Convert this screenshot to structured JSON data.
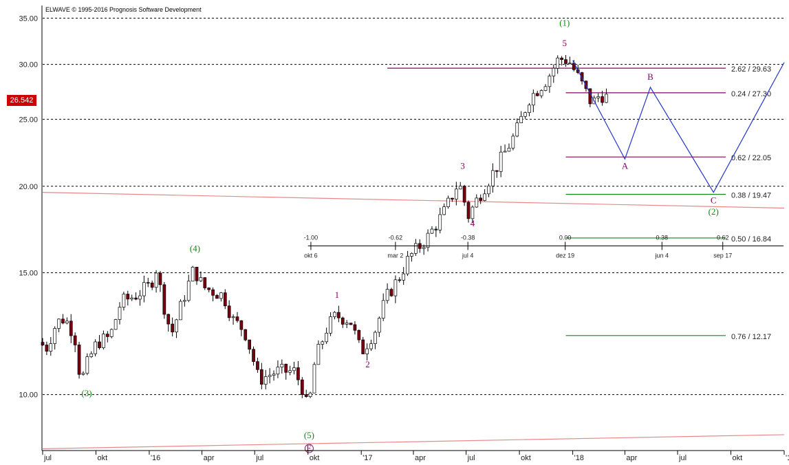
{
  "header": {
    "copyright": "ELWAVE © 1995-2016 Prognosis Software Development"
  },
  "price_badge": {
    "label": "26.542"
  },
  "colors": {
    "bull": "#ffffff",
    "bear": "#7a0010",
    "wick": "#000000",
    "projection": "#2233cc",
    "purple": "#880066",
    "green": "#118811",
    "channel": "#e88888",
    "grid": "#000000"
  },
  "chart_data": {
    "type": "candlestick",
    "y_scale": "log",
    "ylim": [
      8.3,
      36.5
    ],
    "y_ticks": [
      {
        "value": 35,
        "label": "35.00"
      },
      {
        "value": 30,
        "label": "30.00"
      },
      {
        "value": 25,
        "label": "25.00"
      },
      {
        "value": 20,
        "label": "20.00"
      },
      {
        "value": 15,
        "label": "15.00"
      },
      {
        "value": 10,
        "label": "10.00"
      }
    ],
    "x_axis": {
      "start": "2015-07-01",
      "end": "2019-01-01",
      "ticks": [
        {
          "date": "2015-07-01",
          "label": "jul"
        },
        {
          "date": "2015-10-01",
          "label": "okt"
        },
        {
          "date": "2016-01-01",
          "label": "'16"
        },
        {
          "date": "2016-04-01",
          "label": "apr"
        },
        {
          "date": "2016-07-01",
          "label": "jul"
        },
        {
          "date": "2016-10-01",
          "label": "okt"
        },
        {
          "date": "2017-01-01",
          "label": "'17"
        },
        {
          "date": "2017-04-01",
          "label": "apr"
        },
        {
          "date": "2017-07-01",
          "label": "jul"
        },
        {
          "date": "2017-10-01",
          "label": "okt"
        },
        {
          "date": "2018-01-01",
          "label": "'18"
        },
        {
          "date": "2018-04-01",
          "label": "apr"
        },
        {
          "date": "2018-07-01",
          "label": "jul"
        },
        {
          "date": "2018-10-01",
          "label": "okt"
        },
        {
          "date": "2019-01-01",
          "label": "'1"
        }
      ]
    },
    "price_path": [
      [
        "2015-07-01",
        11.9
      ],
      [
        "2015-07-15",
        11.7
      ],
      [
        "2015-08-01",
        12.7
      ],
      [
        "2015-08-15",
        12.9
      ],
      [
        "2015-09-01",
        12.2
      ],
      [
        "2015-09-12",
        10.4
      ],
      [
        "2015-09-25",
        11.2
      ],
      [
        "2015-10-10",
        11.9
      ],
      [
        "2015-11-01",
        12.1
      ],
      [
        "2015-11-20",
        13.6
      ],
      [
        "2015-12-15",
        13.9
      ],
      [
        "2016-01-10",
        14.4
      ],
      [
        "2016-01-20",
        15.2
      ],
      [
        "2016-02-01",
        13.6
      ],
      [
        "2016-02-15",
        12.2
      ],
      [
        "2016-03-10",
        14.0
      ],
      [
        "2016-03-25",
        15.2
      ],
      [
        "2016-04-10",
        14.3
      ],
      [
        "2016-05-15",
        13.9
      ],
      [
        "2016-06-01",
        12.8
      ],
      [
        "2016-06-20",
        12.4
      ],
      [
        "2016-07-01",
        11.6
      ],
      [
        "2016-07-15",
        10.5
      ],
      [
        "2016-08-15",
        10.8
      ],
      [
        "2016-09-15",
        10.8
      ],
      [
        "2016-10-01",
        10.1
      ],
      [
        "2016-10-08",
        9.4
      ],
      [
        "2016-10-20",
        11.2
      ],
      [
        "2016-11-10",
        12.5
      ],
      [
        "2016-11-25",
        13.0
      ],
      [
        "2016-12-20",
        12.8
      ],
      [
        "2017-01-08",
        11.5
      ],
      [
        "2017-02-01",
        12.4
      ],
      [
        "2017-02-20",
        13.8
      ],
      [
        "2017-03-15",
        14.8
      ],
      [
        "2017-04-01",
        15.8
      ],
      [
        "2017-05-01",
        16.8
      ],
      [
        "2017-06-01",
        18.4
      ],
      [
        "2017-06-25",
        20.3
      ],
      [
        "2017-07-05",
        19.0
      ],
      [
        "2017-07-10",
        18.0
      ],
      [
        "2017-08-01",
        19.5
      ],
      [
        "2017-09-01",
        21.5
      ],
      [
        "2017-10-01",
        23.8
      ],
      [
        "2017-10-25",
        26.8
      ],
      [
        "2017-11-25",
        28.6
      ],
      [
        "2017-12-15",
        30.6
      ],
      [
        "2018-01-01",
        30.4
      ],
      [
        "2018-01-20",
        28.5
      ],
      [
        "2018-02-10",
        26.3
      ],
      [
        "2018-02-25",
        27.2
      ],
      [
        "2018-03-05",
        26.9
      ]
    ],
    "projection": [
      [
        "2018-01-01",
        30.4
      ],
      [
        "2018-04-01",
        21.9
      ],
      [
        "2018-05-15",
        27.8
      ],
      [
        "2018-09-01",
        19.6
      ],
      [
        "2019-01-01",
        30.2
      ]
    ],
    "fib_levels": [
      {
        "label": "2.62 / 29.63",
        "value": 29.63,
        "start": "2017-02-15",
        "color": "purple"
      },
      {
        "label": "0.24 / 27.30",
        "value": 27.3,
        "start": "2017-12-20",
        "color": "purple"
      },
      {
        "label": "0.62 / 22.05",
        "value": 22.05,
        "start": "2017-12-20",
        "color": "purple"
      },
      {
        "label": "0.38 / 19.47",
        "value": 19.47,
        "start": "2017-12-20",
        "color": "green"
      },
      {
        "label": "0.50 / 16.84",
        "value": 16.84,
        "start": "2017-12-20",
        "color": "green"
      },
      {
        "label": "0.76 / 12.17",
        "value": 12.17,
        "start": "2017-12-20",
        "color": "green"
      }
    ],
    "channel_lines": [
      {
        "from": [
          "2015-07-01",
          19.6
        ],
        "to": [
          "2019-01-01",
          18.6
        ]
      },
      {
        "from": [
          "2015-07-01",
          8.35
        ],
        "to": [
          "2019-01-01",
          8.75
        ]
      }
    ],
    "time_ratio_axis": {
      "y_value": 16.4,
      "from": "2016-10-01",
      "to": "2018-12-31",
      "ticks": [
        {
          "date": "2016-10-06",
          "ratio": "-1.00",
          "label": "okt 6"
        },
        {
          "date": "2017-03-01",
          "ratio": "-0.62",
          "label": "mar 2"
        },
        {
          "date": "2017-07-04",
          "ratio": "-0.38",
          "label": "jul 4"
        },
        {
          "date": "2017-12-19",
          "ratio": "0.00",
          "label": "dez 19"
        },
        {
          "date": "2018-06-04",
          "ratio": "0.38",
          "label": "jun 4"
        },
        {
          "date": "2018-09-17",
          "ratio": "0.62",
          "label": "sep 17"
        }
      ]
    },
    "wave_labels": [
      {
        "text": "(1)",
        "date": "2017-12-18",
        "value": 34.1,
        "color": "green"
      },
      {
        "text": "5",
        "date": "2017-12-18",
        "value": 31.9,
        "color": "purple"
      },
      {
        "text": "(4)",
        "date": "2016-03-20",
        "value": 16.1,
        "color": "green"
      },
      {
        "text": "(3)",
        "date": "2015-09-15",
        "value": 9.95,
        "color": "green"
      },
      {
        "text": "(5)",
        "date": "2016-10-03",
        "value": 8.65,
        "color": "green"
      },
      {
        "text": "E",
        "date": "2016-10-03",
        "value": 8.28,
        "color": "purple"
      },
      {
        "text": "1",
        "date": "2016-11-20",
        "value": 13.8,
        "color": "purple"
      },
      {
        "text": "2",
        "date": "2017-01-12",
        "value": 10.95,
        "color": "purple"
      },
      {
        "text": "3",
        "date": "2017-06-25",
        "value": 21.2,
        "color": "purple"
      },
      {
        "text": "4",
        "date": "2017-07-12",
        "value": 17.5,
        "color": "purple"
      },
      {
        "text": "A",
        "date": "2018-04-01",
        "value": 21.2,
        "color": "purple"
      },
      {
        "text": "B",
        "date": "2018-05-15",
        "value": 28.5,
        "color": "purple"
      },
      {
        "text": "C",
        "date": "2018-09-01",
        "value": 18.9,
        "color": "purple"
      },
      {
        "text": "(2)",
        "date": "2018-09-01",
        "value": 18.2,
        "color": "green"
      }
    ]
  }
}
